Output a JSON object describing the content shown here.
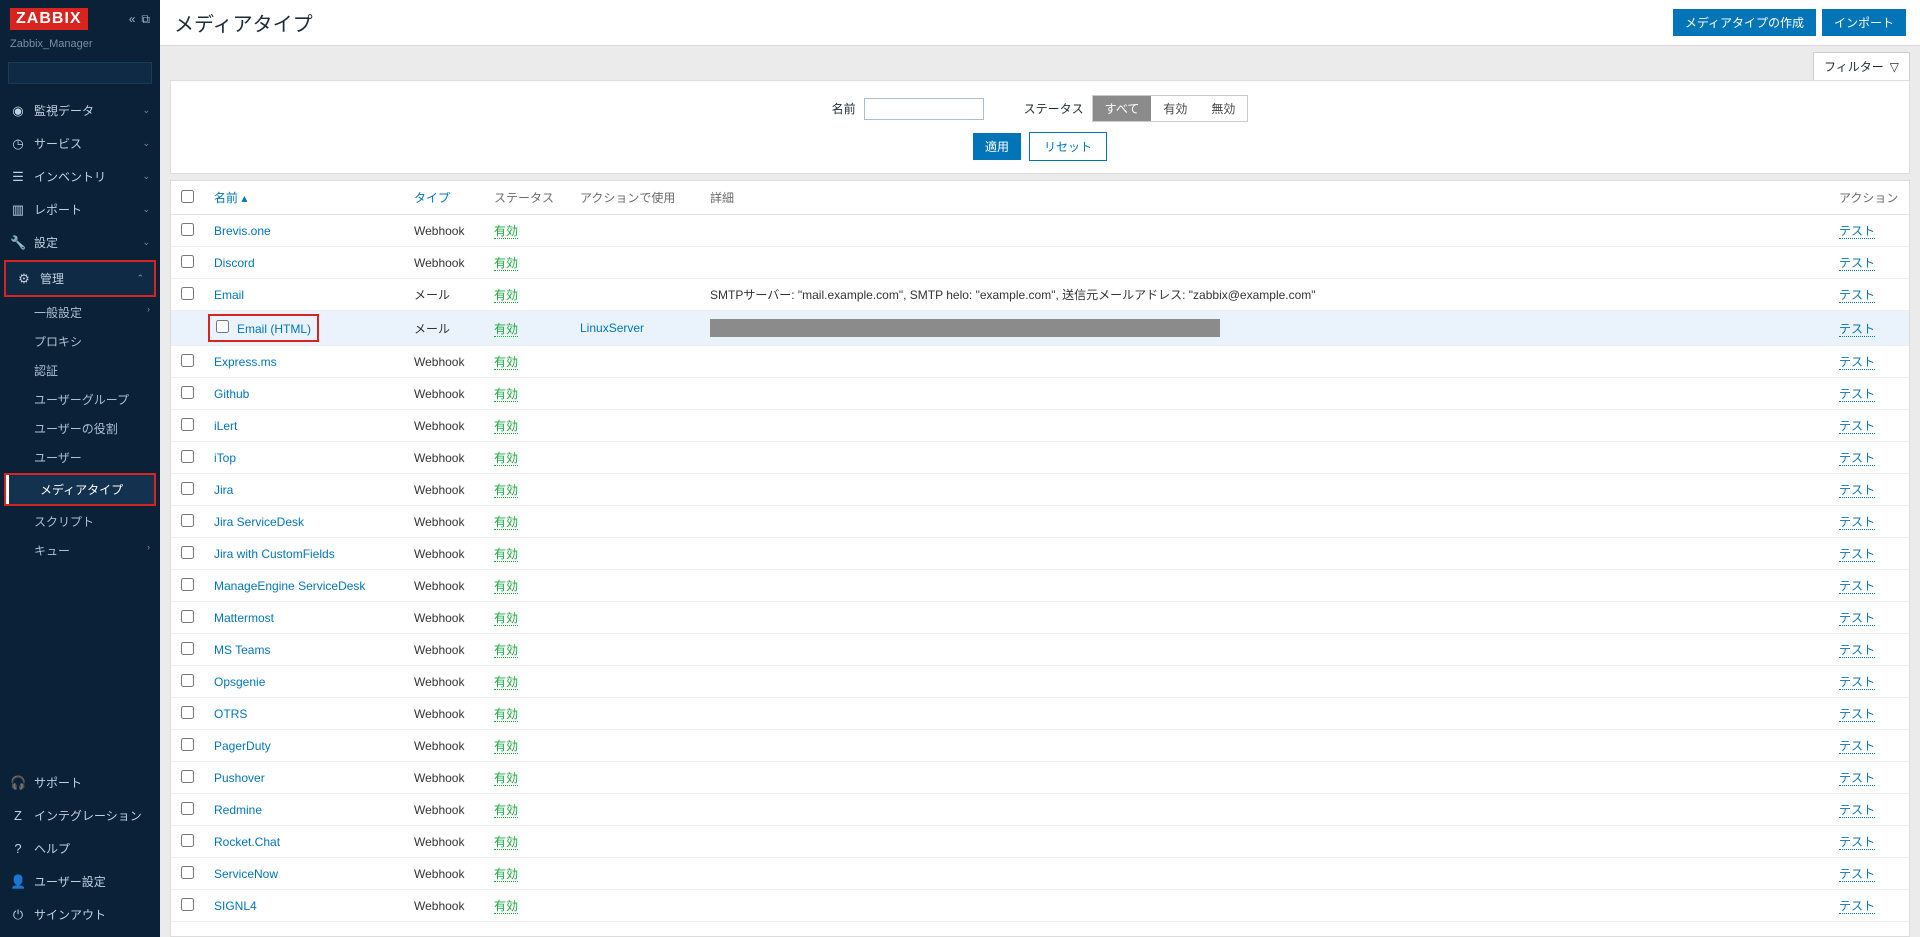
{
  "brand": "ZABBIX",
  "server_name": "Zabbix_Manager",
  "page_title": "メディアタイプ",
  "top_buttons": {
    "create": "メディアタイプの作成",
    "import": "インポート"
  },
  "filter_tab": "フィルター",
  "filter": {
    "name_label": "名前",
    "status_label": "ステータス",
    "seg_all": "すべて",
    "seg_enabled": "有効",
    "seg_disabled": "無効",
    "apply": "適用",
    "reset": "リセット"
  },
  "nav": {
    "monitoring": "監視データ",
    "services": "サービス",
    "inventory": "インベントリ",
    "reports": "レポート",
    "config": "設定",
    "admin": "管理",
    "admin_sub": {
      "general": "一般設定",
      "proxy": "プロキシ",
      "auth": "認証",
      "usergroups": "ユーザーグループ",
      "userroles": "ユーザーの役割",
      "users": "ユーザー",
      "mediatypes": "メディアタイプ",
      "scripts": "スクリプト",
      "queue": "キュー"
    },
    "support": "サポート",
    "integrations": "インテグレーション",
    "help": "ヘルプ",
    "usersettings": "ユーザー設定",
    "signout": "サインアウト"
  },
  "columns": {
    "name": "名前",
    "type": "タイプ",
    "status": "ステータス",
    "used": "アクションで使用",
    "detail": "詳細",
    "action": "アクション"
  },
  "status_enabled": "有効",
  "test_label": "テスト",
  "types": {
    "webhook": "Webhook",
    "mail": "メール"
  },
  "email_detail": "SMTPサーバー: \"mail.example.com\", SMTP helo: \"example.com\", 送信元メールアドレス: \"zabbix@example.com\"",
  "linuxserver": "LinuxServer",
  "rows": [
    {
      "name": "Brevis.one",
      "type": "webhook"
    },
    {
      "name": "Discord",
      "type": "webhook"
    },
    {
      "name": "Email",
      "type": "mail",
      "detail": "email_detail"
    },
    {
      "name": "Email (HTML)",
      "type": "mail",
      "used": "linuxserver",
      "masked": true,
      "highlight": true
    },
    {
      "name": "Express.ms",
      "type": "webhook"
    },
    {
      "name": "Github",
      "type": "webhook"
    },
    {
      "name": "iLert",
      "type": "webhook"
    },
    {
      "name": "iTop",
      "type": "webhook"
    },
    {
      "name": "Jira",
      "type": "webhook"
    },
    {
      "name": "Jira ServiceDesk",
      "type": "webhook"
    },
    {
      "name": "Jira with CustomFields",
      "type": "webhook"
    },
    {
      "name": "ManageEngine ServiceDesk",
      "type": "webhook"
    },
    {
      "name": "Mattermost",
      "type": "webhook"
    },
    {
      "name": "MS Teams",
      "type": "webhook"
    },
    {
      "name": "Opsgenie",
      "type": "webhook"
    },
    {
      "name": "OTRS",
      "type": "webhook"
    },
    {
      "name": "PagerDuty",
      "type": "webhook"
    },
    {
      "name": "Pushover",
      "type": "webhook"
    },
    {
      "name": "Redmine",
      "type": "webhook"
    },
    {
      "name": "Rocket.Chat",
      "type": "webhook"
    },
    {
      "name": "ServiceNow",
      "type": "webhook"
    },
    {
      "name": "SIGNL4",
      "type": "webhook"
    }
  ]
}
